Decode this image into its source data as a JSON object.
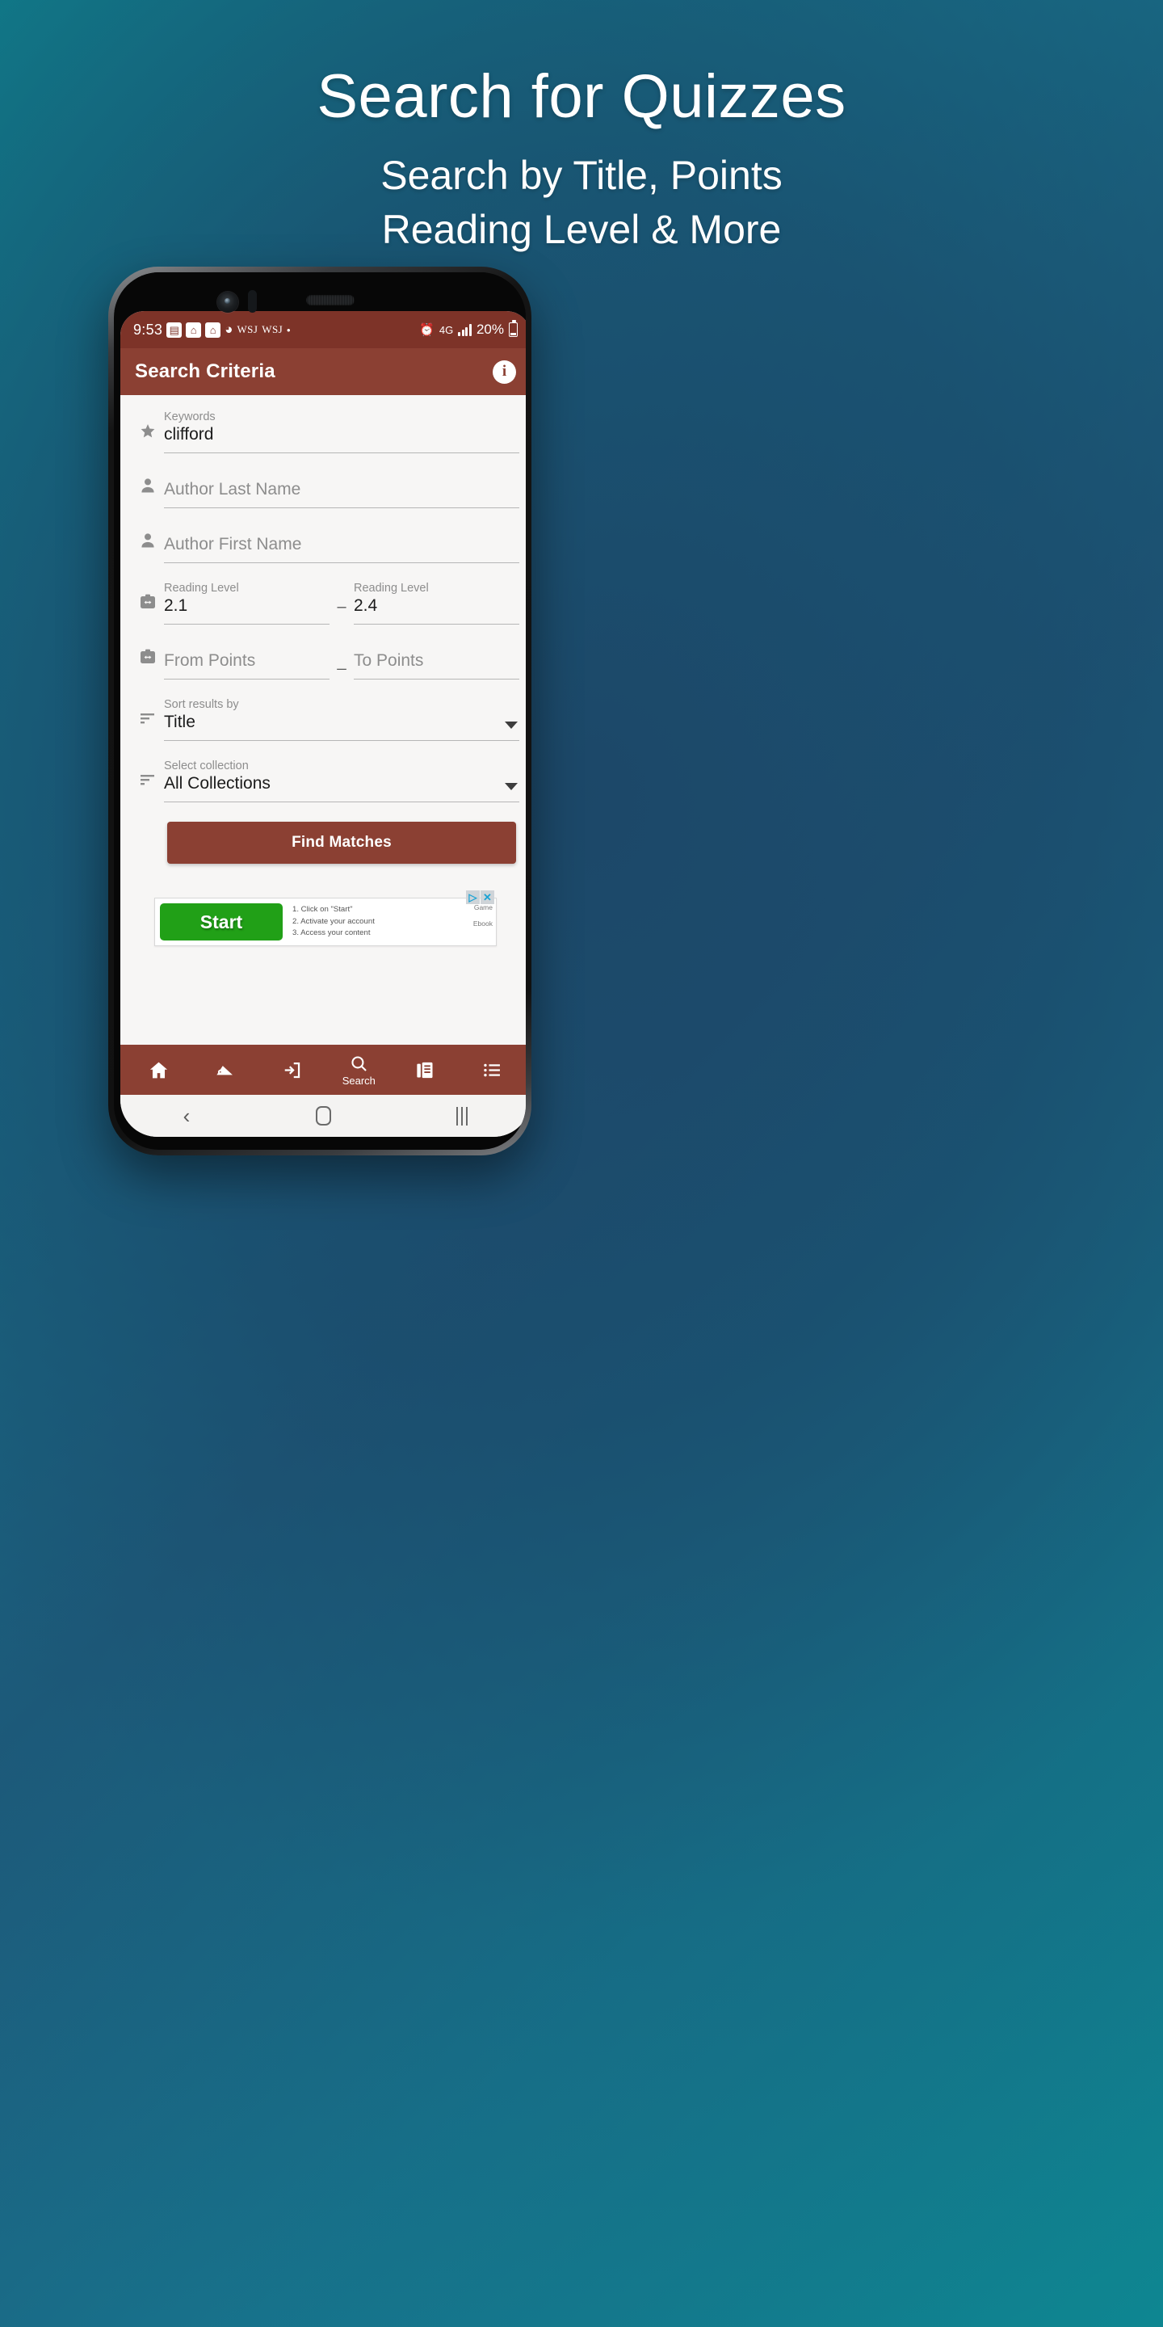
{
  "hero": {
    "title": "Search for Quizzes",
    "subtitle_line1": "Search by Title, Points",
    "subtitle_line2": "Reading Level & More"
  },
  "colors": {
    "brand_primary": "#8b4033",
    "status_bar": "#7d3328",
    "accent_green": "#21a017",
    "bg_teal": "#0e8691",
    "bg_navy": "#1f4a6b"
  },
  "status_bar": {
    "time": "9:53",
    "icons": [
      "news-icon",
      "home-icon",
      "home-icon",
      "apple-icon"
    ],
    "apple_glyph": "◕",
    "news_glyph": "▤",
    "home_glyph": "⌂",
    "wsj_1": "WSJ",
    "wsj_2": "WSJ",
    "dot": "•",
    "alarm_glyph": "⏰",
    "network": "4G",
    "battery_percent": "20%"
  },
  "app_bar": {
    "title": "Search Criteria",
    "info_glyph": "i"
  },
  "form": {
    "keywords": {
      "label": "Keywords",
      "value": "clifford",
      "icon": "star-icon"
    },
    "author_last": {
      "placeholder": "Author Last Name",
      "icon": "person-icon"
    },
    "author_first": {
      "placeholder": "Author First Name",
      "icon": "person-icon"
    },
    "reading_level": {
      "icon": "range-icon",
      "from_label": "Reading Level",
      "from_value": "2.1",
      "separator": "–",
      "to_label": "Reading Level",
      "to_value": "2.4"
    },
    "points": {
      "icon": "range-icon",
      "from_placeholder": "From Points",
      "separator": "_",
      "to_placeholder": "To Points"
    },
    "sort": {
      "icon": "sort-icon",
      "label": "Sort results by",
      "value": "Title"
    },
    "collection": {
      "icon": "sort-icon",
      "label": "Select collection",
      "value": "All Collections"
    },
    "submit_label": "Find Matches"
  },
  "ad": {
    "start_label": "Start",
    "step1": "1. Click on \"Start\"",
    "step2": "2. Activate your account",
    "step3": "3. Access your content",
    "side_label_1": "Game",
    "side_label_2": "Ebook",
    "adchoices_play": "▷",
    "adchoices_close": "✕"
  },
  "bottom_nav": {
    "items": [
      {
        "name": "home",
        "label": ""
      },
      {
        "name": "scanner",
        "label": ""
      },
      {
        "name": "login",
        "label": ""
      },
      {
        "name": "search",
        "label": "Search"
      },
      {
        "name": "books",
        "label": ""
      },
      {
        "name": "list",
        "label": ""
      }
    ]
  },
  "android_nav": {
    "back": "‹",
    "home": "home-pill",
    "recents": "recents-icon"
  }
}
